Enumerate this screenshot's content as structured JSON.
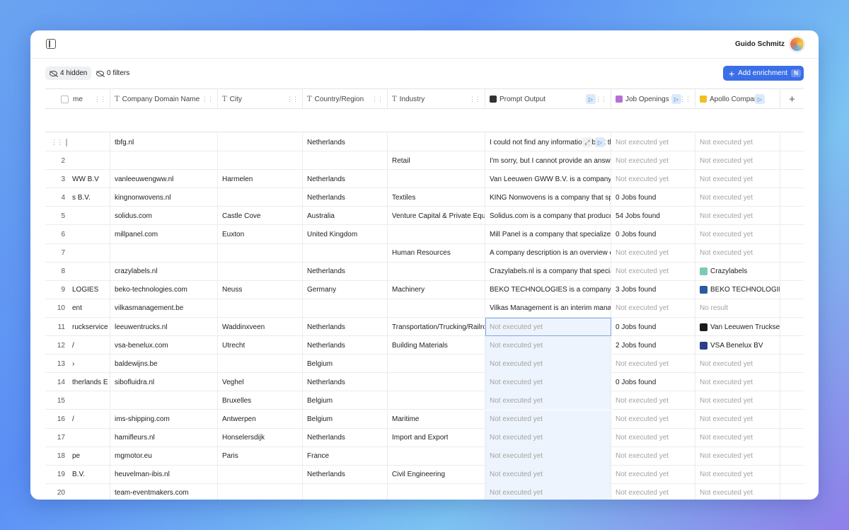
{
  "user": {
    "name": "Guido Schmitz"
  },
  "toolbar": {
    "hidden_label": "4 hidden",
    "filters_label": "0 filters",
    "add_enrichment_label": "Add enrichment",
    "add_enrichment_shortcut": "N"
  },
  "columns": {
    "name": "me",
    "domain": "Company Domain Name",
    "city": "City",
    "country": "Country/Region",
    "industry": "Industry",
    "prompt": "Prompt Output",
    "jobs": "Job Openings",
    "apollo": "Apollo Company"
  },
  "colors": {
    "accent": "#3b6fe8",
    "muted_text": "#a3a3a3",
    "pending_bg": "#eef4fd"
  },
  "rows": [
    {
      "num": "",
      "name": "",
      "domain": "tbfg.nl",
      "city": "",
      "country": "Netherlands",
      "industry": "",
      "prompt": "I could not find any information about the",
      "prompt_pending": false,
      "jobs": "Not executed yet",
      "jobs_muted": true,
      "apollo": "Not executed yet",
      "apollo_muted": true,
      "apollo_logo": ""
    },
    {
      "num": "2",
      "name": "",
      "domain": "",
      "city": "",
      "country": "",
      "industry": "Retail",
      "prompt": "I'm sorry, but I cannot provide an answer",
      "prompt_pending": false,
      "jobs": "Not executed yet",
      "jobs_muted": true,
      "apollo": "Not executed yet",
      "apollo_muted": true,
      "apollo_logo": ""
    },
    {
      "num": "3",
      "name": "WW B.V",
      "domain": "vanleeuwengww.nl",
      "city": "Harmelen",
      "country": "Netherlands",
      "industry": "",
      "prompt": "Van Leeuwen GWW B.V. is a company based",
      "prompt_pending": false,
      "jobs": "Not executed yet",
      "jobs_muted": true,
      "apollo": "Not executed yet",
      "apollo_muted": true,
      "apollo_logo": ""
    },
    {
      "num": "4",
      "name": "s B.V.",
      "domain": "kingnonwovens.nl",
      "city": "",
      "country": "Netherlands",
      "industry": "Textiles",
      "prompt": "KING Nonwovens is a company that special",
      "prompt_pending": false,
      "jobs": "0 Jobs found",
      "jobs_muted": false,
      "apollo": "Not executed yet",
      "apollo_muted": true,
      "apollo_logo": ""
    },
    {
      "num": "5",
      "name": "",
      "domain": "solidus.com",
      "city": "Castle Cove",
      "country": "Australia",
      "industry": "Venture Capital & Private Equity",
      "prompt": "Solidus.com is a company that produces",
      "prompt_pending": false,
      "jobs": "54 Jobs found",
      "jobs_muted": false,
      "apollo": "Not executed yet",
      "apollo_muted": true,
      "apollo_logo": ""
    },
    {
      "num": "6",
      "name": "",
      "domain": "millpanel.com",
      "city": "Euxton",
      "country": "United Kingdom",
      "industry": "",
      "prompt": "Mill Panel is a company that specializes in",
      "prompt_pending": false,
      "jobs": "0 Jobs found",
      "jobs_muted": false,
      "apollo": "Not executed yet",
      "apollo_muted": true,
      "apollo_logo": ""
    },
    {
      "num": "7",
      "name": "",
      "domain": "",
      "city": "",
      "country": "",
      "industry": "Human Resources",
      "prompt": "A company description is an overview or",
      "prompt_pending": false,
      "jobs": "Not executed yet",
      "jobs_muted": true,
      "apollo": "Not executed yet",
      "apollo_muted": true,
      "apollo_logo": ""
    },
    {
      "num": "8",
      "name": "",
      "domain": "crazylabels.nl",
      "city": "",
      "country": "Netherlands",
      "industry": "",
      "prompt": "Crazylabels.nl is a company that specializes",
      "prompt_pending": false,
      "jobs": "Not executed yet",
      "jobs_muted": true,
      "apollo": "Crazylabels",
      "apollo_muted": false,
      "apollo_logo": "#7cc9b8"
    },
    {
      "num": "9",
      "name": "LOGIES",
      "domain": "beko-technologies.com",
      "city": "Neuss",
      "country": "Germany",
      "industry": "Machinery",
      "prompt": "BEKO TECHNOLOGIES is a company that",
      "prompt_pending": false,
      "jobs": "3 Jobs found",
      "jobs_muted": false,
      "apollo": "BEKO TECHNOLOGIES",
      "apollo_muted": false,
      "apollo_logo": "#2c5aa0"
    },
    {
      "num": "10",
      "name": "ent",
      "domain": "vilkasmanagement.be",
      "city": "",
      "country": "",
      "industry": "",
      "prompt": "Vilkas Management is an interim manager",
      "prompt_pending": false,
      "jobs": "Not executed yet",
      "jobs_muted": true,
      "apollo": "No result",
      "apollo_muted": true,
      "apollo_logo": ""
    },
    {
      "num": "11",
      "name": "ruckservice",
      "domain": "leeuwentrucks.nl",
      "city": "Waddinxveen",
      "country": "Netherlands",
      "industry": "Transportation/Trucking/Railroad",
      "prompt": "Not executed yet",
      "prompt_pending": true,
      "jobs": "0 Jobs found",
      "jobs_muted": false,
      "apollo": "Van Leeuwen Truckservice",
      "apollo_muted": false,
      "apollo_logo": "#1b1b1b"
    },
    {
      "num": "12",
      "name": "/",
      "domain": "vsa-benelux.com",
      "city": "Utrecht",
      "country": "Netherlands",
      "industry": "Building Materials",
      "prompt": "Not executed yet",
      "prompt_pending": true,
      "jobs": "2 Jobs found",
      "jobs_muted": false,
      "apollo": "VSA Benelux BV",
      "apollo_muted": false,
      "apollo_logo": "#2b3f8c"
    },
    {
      "num": "13",
      "name": "›",
      "domain": "baldewijns.be",
      "city": "",
      "country": "Belgium",
      "industry": "",
      "prompt": "Not executed yet",
      "prompt_pending": true,
      "jobs": "Not executed yet",
      "jobs_muted": true,
      "apollo": "Not executed yet",
      "apollo_muted": true,
      "apollo_logo": ""
    },
    {
      "num": "14",
      "name": "therlands E",
      "domain": "sibofluidra.nl",
      "city": "Veghel",
      "country": "Netherlands",
      "industry": "",
      "prompt": "Not executed yet",
      "prompt_pending": true,
      "jobs": "0 Jobs found",
      "jobs_muted": false,
      "apollo": "Not executed yet",
      "apollo_muted": true,
      "apollo_logo": ""
    },
    {
      "num": "15",
      "name": "",
      "domain": "",
      "city": "Bruxelles",
      "country": "Belgium",
      "industry": "",
      "prompt": "Not executed yet",
      "prompt_pending": true,
      "jobs": "Not executed yet",
      "jobs_muted": true,
      "apollo": "Not executed yet",
      "apollo_muted": true,
      "apollo_logo": ""
    },
    {
      "num": "16",
      "name": "/",
      "domain": "ims-shipping.com",
      "city": "Antwerpen",
      "country": "Belgium",
      "industry": "Maritime",
      "prompt": "Not executed yet",
      "prompt_pending": true,
      "jobs": "Not executed yet",
      "jobs_muted": true,
      "apollo": "Not executed yet",
      "apollo_muted": true,
      "apollo_logo": ""
    },
    {
      "num": "17",
      "name": "",
      "domain": "hamifleurs.nl",
      "city": "Honselersdijk",
      "country": "Netherlands",
      "industry": "Import and Export",
      "prompt": "Not executed yet",
      "prompt_pending": true,
      "jobs": "Not executed yet",
      "jobs_muted": true,
      "apollo": "Not executed yet",
      "apollo_muted": true,
      "apollo_logo": ""
    },
    {
      "num": "18",
      "name": "pe",
      "domain": "mgmotor.eu",
      "city": "Paris",
      "country": "France",
      "industry": "",
      "prompt": "Not executed yet",
      "prompt_pending": true,
      "jobs": "Not executed yet",
      "jobs_muted": true,
      "apollo": "Not executed yet",
      "apollo_muted": true,
      "apollo_logo": ""
    },
    {
      "num": "19",
      "name": "B.V.",
      "domain": "heuvelman-ibis.nl",
      "city": "",
      "country": "Netherlands",
      "industry": "Civil Engineering",
      "prompt": "Not executed yet",
      "prompt_pending": true,
      "jobs": "Not executed yet",
      "jobs_muted": true,
      "apollo": "Not executed yet",
      "apollo_muted": true,
      "apollo_logo": ""
    },
    {
      "num": "20",
      "name": "",
      "domain": "team-eventmakers.com",
      "city": "",
      "country": "",
      "industry": "",
      "prompt": "Not executed yet",
      "prompt_pending": true,
      "jobs": "Not executed yet",
      "jobs_muted": true,
      "apollo": "Not executed yet",
      "apollo_muted": true,
      "apollo_logo": ""
    }
  ]
}
